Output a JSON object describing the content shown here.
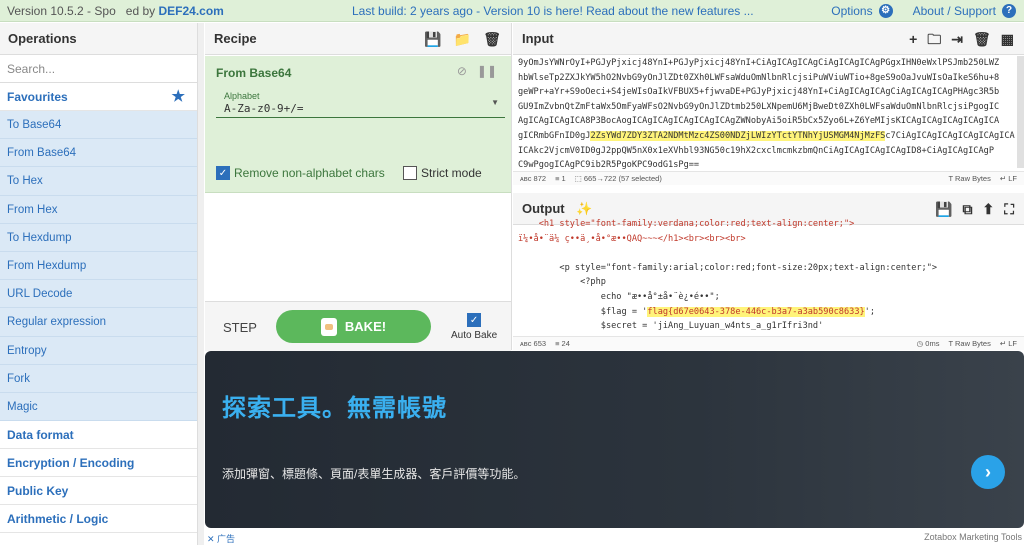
{
  "banner": {
    "version_label": "Version 10.5.2 - Spo",
    "sponsored_rest": "ed by",
    "brand": "DEF24.com",
    "middle_text": "Last build: 2 years ago - Version 10 is here! Read about the new features ...",
    "options_label": "Options",
    "about_label": "About / Support"
  },
  "operations": {
    "title": "Operations",
    "search_placeholder": "Search...",
    "favourites_label": "Favourites",
    "items": [
      "To Base64",
      "From Base64",
      "To Hex",
      "From Hex",
      "To Hexdump",
      "From Hexdump",
      "URL Decode",
      "Regular expression",
      "Entropy",
      "Fork",
      "Magic"
    ],
    "categories": [
      "Data format",
      "Encryption / Encoding",
      "Public Key",
      "Arithmetic / Logic"
    ]
  },
  "recipe": {
    "title": "Recipe",
    "operation_name": "From Base64",
    "alphabet_label": "Alphabet",
    "alphabet_value": "A-Za-z0-9+/=",
    "remove_non_alpha_label": "Remove non-alphabet chars",
    "remove_non_alpha_checked": true,
    "strict_mode_label": "Strict mode",
    "strict_mode_checked": false,
    "step_label": "STEP",
    "bake_label": "BAKE!",
    "auto_bake_label": "Auto Bake",
    "auto_bake_checked": true
  },
  "input": {
    "title": "Input",
    "lines": [
      "9yOmJsYWNrOyI+PGJyPjxicj48YnI+PGJyPjxicj48YnI+CiAgICAgICAgCiAgICAgICAgPGgxIHN0eWxlPSJmb250LWZ",
      "hbWlseTp2ZXJkYW5hO2NvbG9yOnJlZDt0ZXh0LWFsaWduOmNlbnRlcjsiPuWViuWTio+8geS9oOaJvuWIsOaIkeS6hu+8",
      "geWPr+aYr+S9oOeci+S4jeWIsOaIkVFBUX5+fjwvaDE+PGJyPjxicj48YnI+CiAgICAgICAgCiAgICAgICAgPHAgc3R5b",
      "GU9ImZvbnQtZmFtaWx5OmFyaWFsO2NvbG9yOnJlZDtmb250LXNpemU6MjBweDt0ZXh0LWFsaWduOmNlbnRlcjsiPgogIC",
      "AgICAgICAgICA8P3BocAogICAgICAgICAgICAgICAgZWNobyAi5oiR5bCx5Zyo6L+Z6YeMIjsKICAgICAgICAgICAgICA",
      "gICRmbGFnID0gJ",
      "AgICAgICAgICAgICAgICAgICAgICAgICAgICAgICAgICAgICAgICAgICAgICAgICAgICAgICAgICAgICAgICAgIA=",
      "C9wPgogICAgPC9ib2R5PgoKPC9odG1sPg=="
    ],
    "highlight": "2ZsYWd7ZDY3ZTA2NDMtMzc4ZS00NDZjLWIzYTctYTNhYjUSMGM4NjMzFS",
    "after_highlight": "c7CiAgICAgICAgICAgICAgICAgICAg",
    "line6_pre": "ICAkc2VjcmV0ID0gJ2ppQW5nX0x1eXVhbl93NG50c19hX2cxclmcmkzbmQnCiAgICAgICAgICAgID8+CiAgICAgICAgP",
    "status_chars": "872",
    "status_lines": "1",
    "status_sel": "665→722 (57 selected)",
    "status_format": "Raw Bytes",
    "status_eol": "LF"
  },
  "output": {
    "title": "Output",
    "line_top": "    <h1 style=\"font-family:verdana;color:red;text-align:center;\">",
    "line_garble": "ï¼•å•¨ä¼ ç••ä¸•å•°æ••QAQ~~~</h1><br><br><br>",
    "line_p": "        <p style=\"font-family:arial;color:red;font-size:20px;text-align:center;\">",
    "line_php": "            <?php",
    "line_echo": "                echo \"æ••å°±å•¨è¿•é••\";",
    "line_flag_pre": "                $flag = '",
    "flag": "flag{d67e0643-378e-446c-b3a7-a3ab590c8633}",
    "line_flag_post": "';",
    "line_secret": "                $secret = 'jiAng_Luyuan_w4nts_a_g1rIfri3nd'",
    "line_close": "            ?>",
    "status_chars": "653",
    "status_lines": "24",
    "status_time": "0ms",
    "status_format": "Raw Bytes",
    "status_eol": "LF"
  },
  "ad": {
    "headline": "探索工具。無需帳號",
    "subtext": "添加彈窗、標題條、頁面/表單生成器、客戶評價等功能。",
    "arrow": "›",
    "footer_left": "✕ 广告",
    "footer_right": "Zotabox Marketing Tools"
  }
}
